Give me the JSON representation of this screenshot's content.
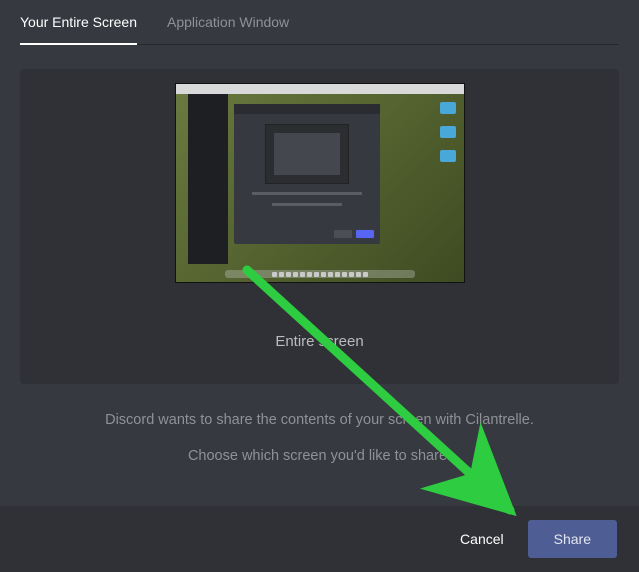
{
  "tabs": {
    "entire_screen": "Your Entire Screen",
    "application_window": "Application Window"
  },
  "preview": {
    "label": "Entire screen"
  },
  "info": {
    "line1": "Discord wants to share the contents of your screen with Cilantrelle.",
    "line2": "Choose which screen you'd like to share."
  },
  "footer": {
    "cancel": "Cancel",
    "share": "Share"
  },
  "annotation": {
    "color": "#2ecc40"
  }
}
